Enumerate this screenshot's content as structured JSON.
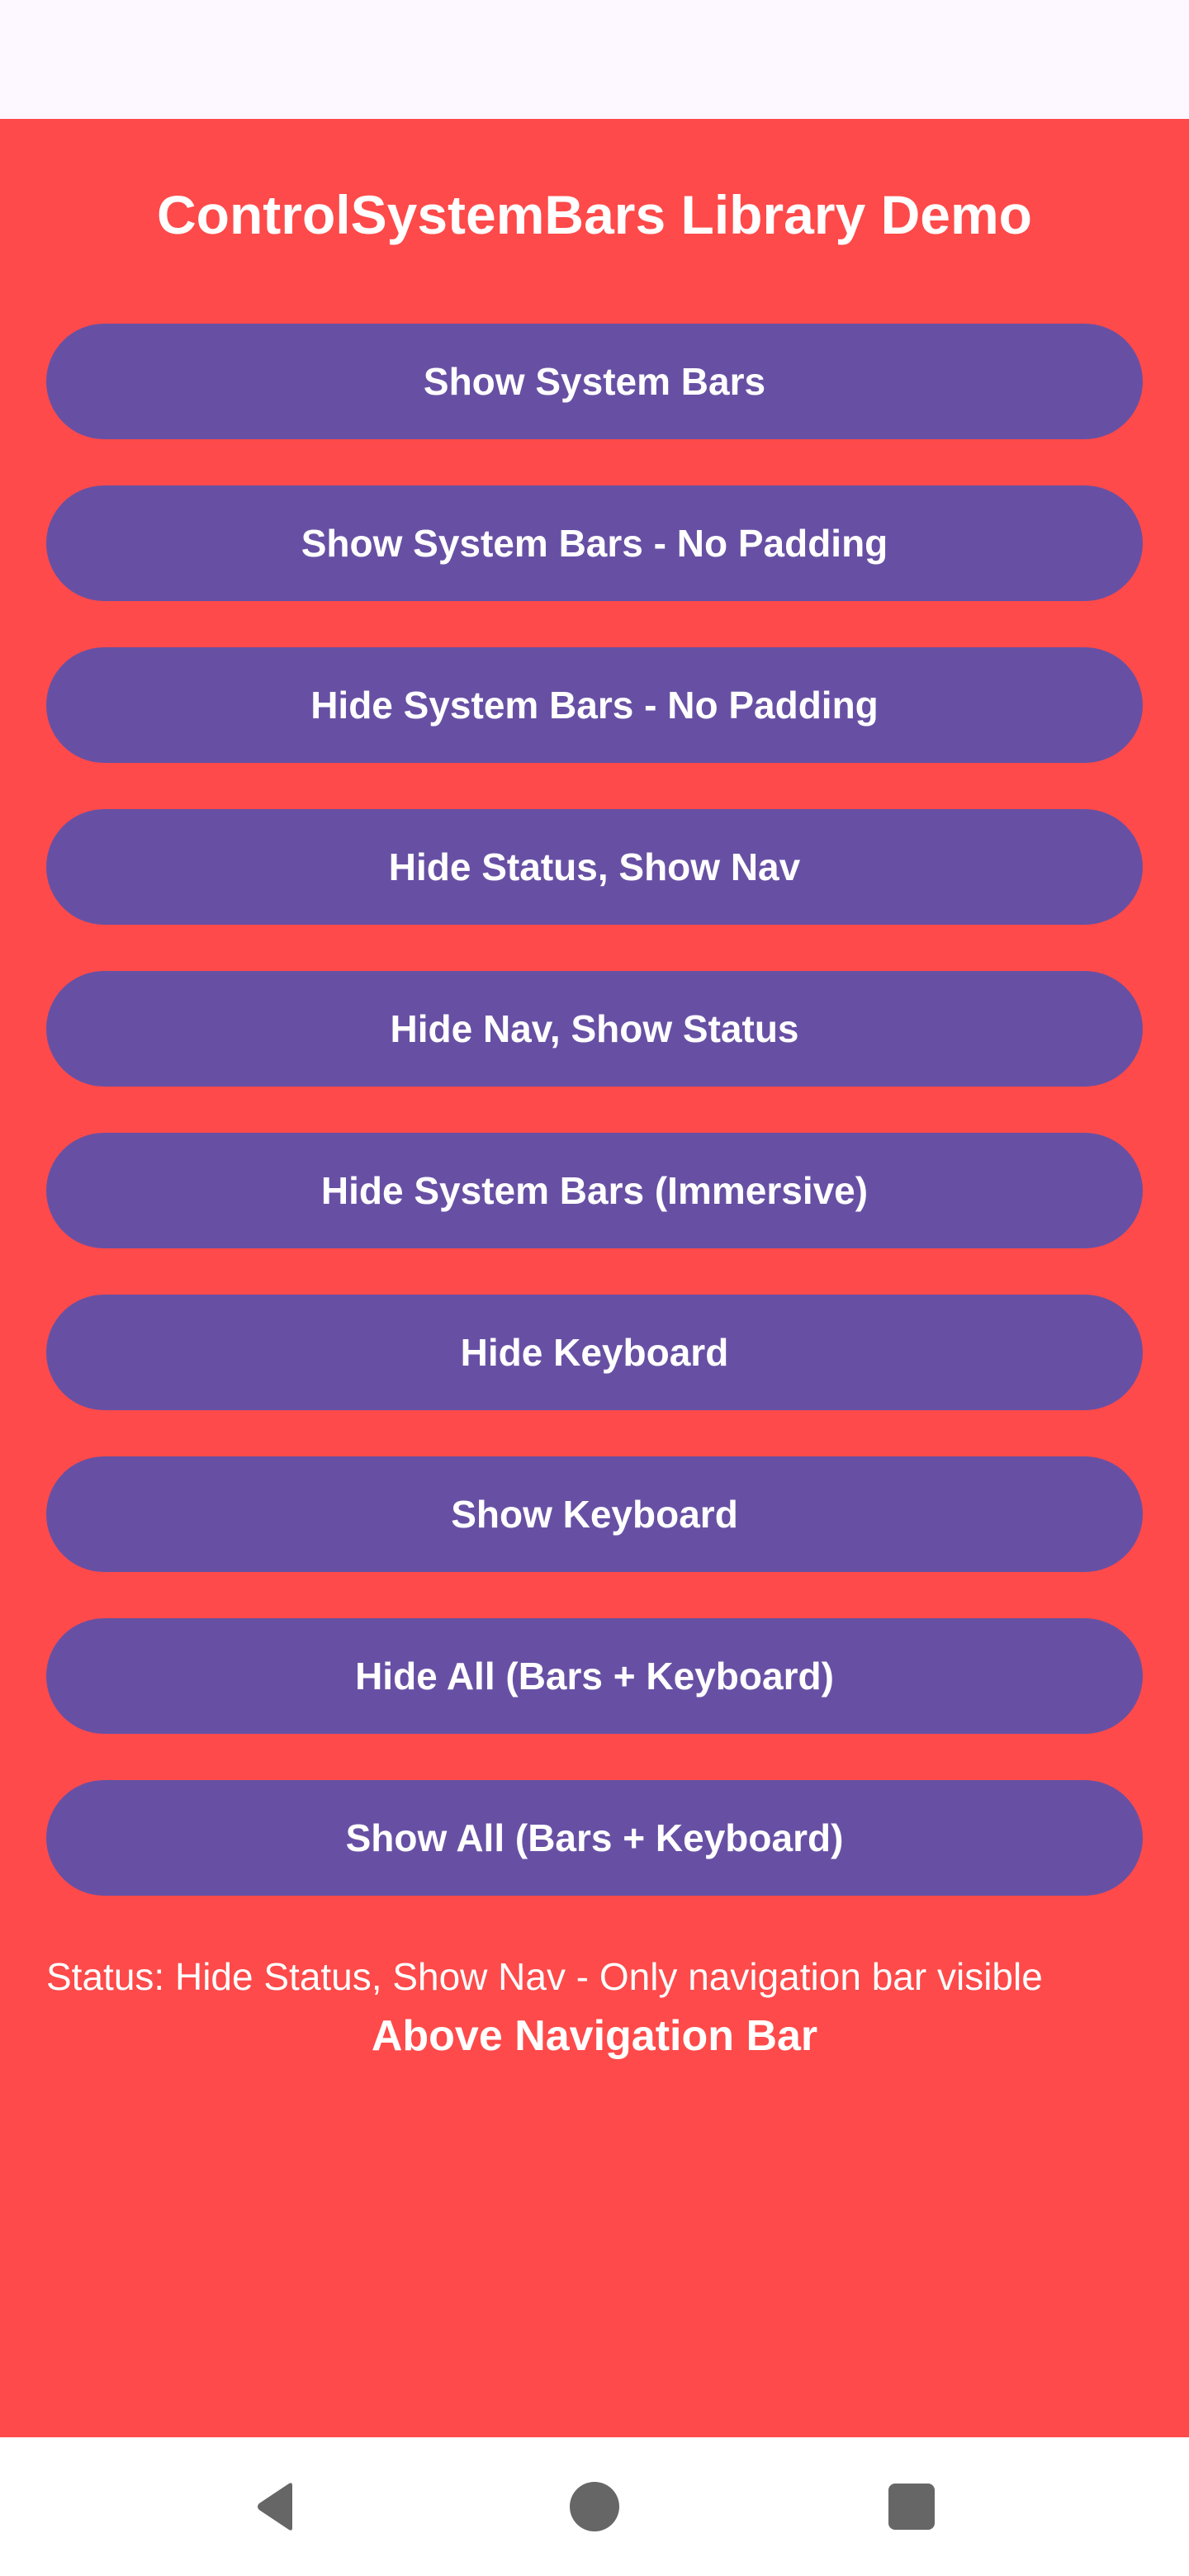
{
  "app": {
    "title": "ControlSystemBars Library Demo",
    "background_color": "#fe4a4a",
    "button_color": "#6750a4"
  },
  "buttons": [
    {
      "label": "Show System Bars"
    },
    {
      "label": "Show System Bars - No Padding"
    },
    {
      "label": "Hide System Bars - No Padding"
    },
    {
      "label": "Hide Status, Show Nav"
    },
    {
      "label": "Hide Nav, Show Status"
    },
    {
      "label": "Hide System Bars (Immersive)"
    },
    {
      "label": "Hide Keyboard"
    },
    {
      "label": "Show Keyboard"
    },
    {
      "label": "Hide All (Bars + Keyboard)"
    },
    {
      "label": "Show All (Bars + Keyboard)"
    }
  ],
  "status": {
    "text": "Status: Hide Status, Show Nav - Only navigation bar visible"
  },
  "footer_label": "Above Navigation Bar",
  "nav_bar": {
    "icons": [
      "back-icon",
      "home-icon",
      "recents-icon"
    ],
    "icon_color": "#666666"
  }
}
